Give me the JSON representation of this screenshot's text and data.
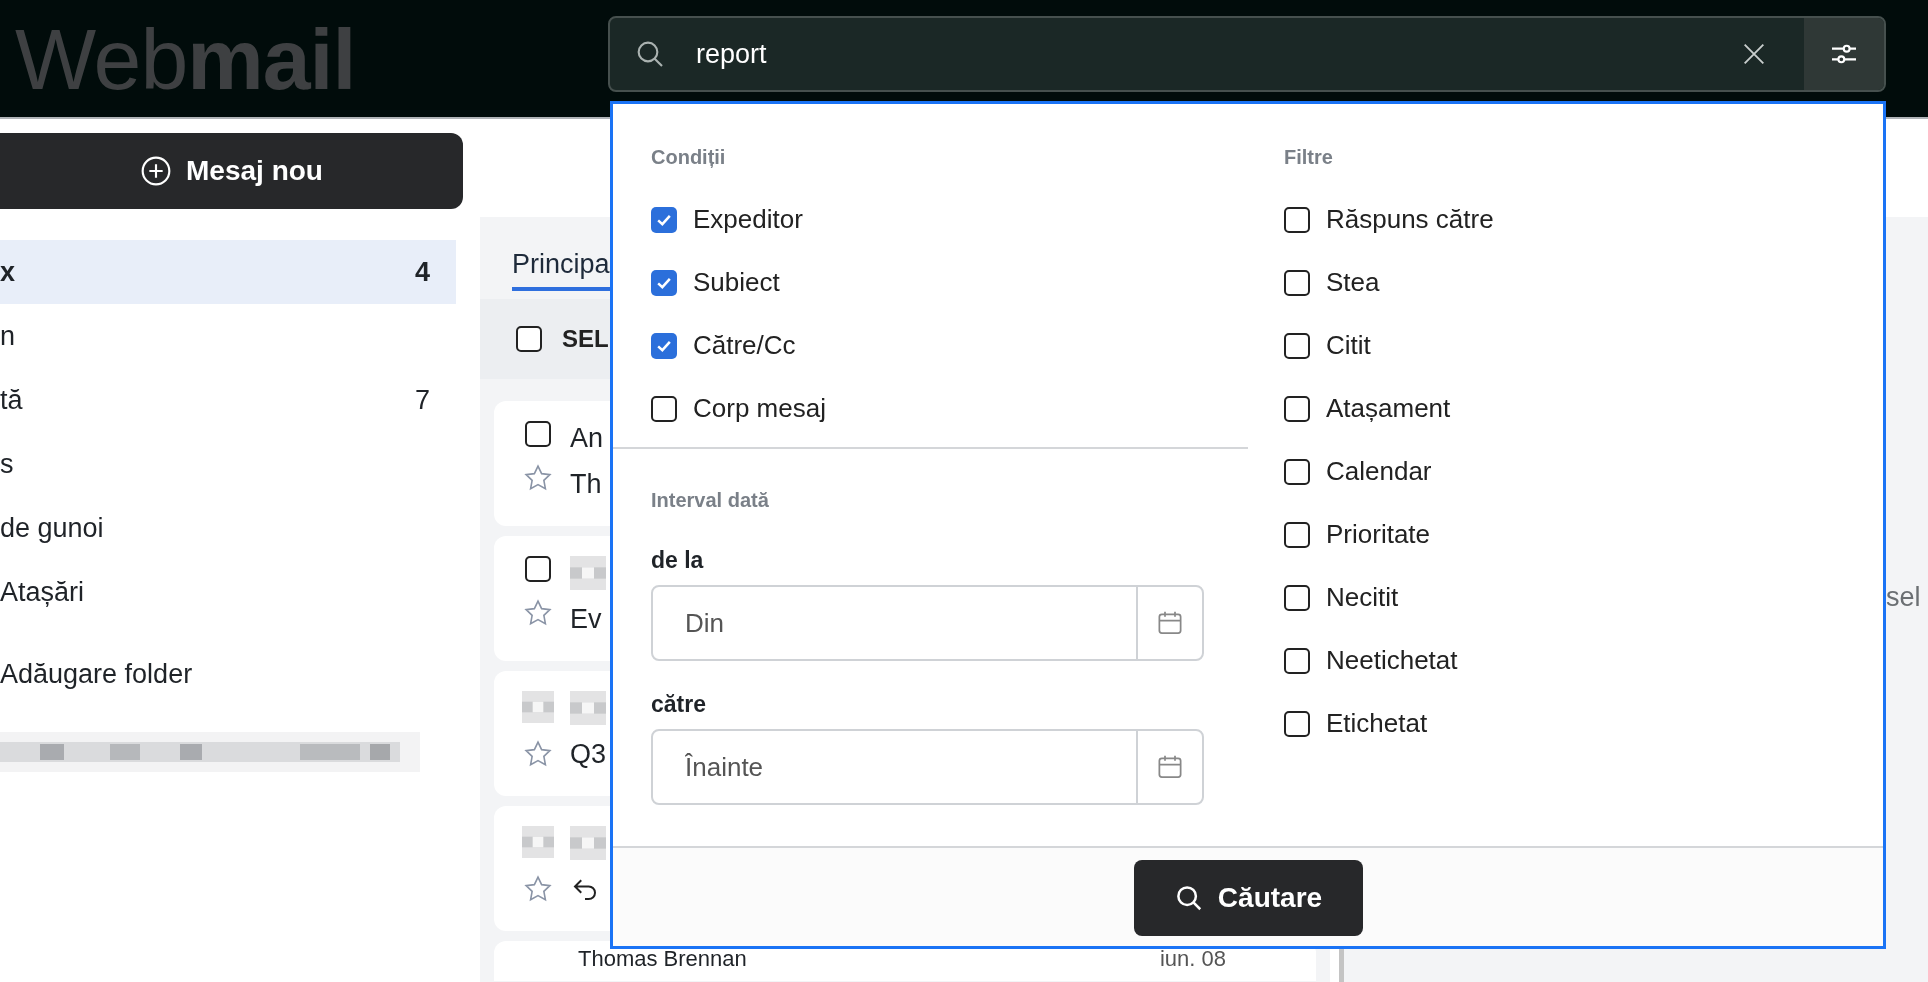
{
  "header": {
    "logo": "Web**mail**",
    "search": {
      "value": "report"
    }
  },
  "sidebar": {
    "compose": "Mesaj nou",
    "folders": [
      {
        "label": "x",
        "count": "4",
        "selected": true
      },
      {
        "label": "n",
        "selected": false
      },
      {
        "label": "tă",
        "count": "7",
        "selected": false
      },
      {
        "label": "s",
        "selected": false
      },
      {
        "label": "de gunoi",
        "selected": false
      },
      {
        "label": "Atașări",
        "selected": false
      }
    ],
    "add_folder": "Adăugare folder"
  },
  "mail_list": {
    "tabs": [
      {
        "label": "Principa",
        "selected": true
      }
    ],
    "select_all": {
      "label": "SEL",
      "checked": false
    },
    "messages": [
      {
        "kind": "checkbox",
        "checked": false,
        "starred": false,
        "sender": "An",
        "subject": "Th"
      },
      {
        "kind": "checkbox",
        "checked": false,
        "starred": false,
        "subject": "Ev"
      },
      {
        "kind": "avatar",
        "starred": false,
        "subject": "Q3"
      },
      {
        "kind": "avatar",
        "starred": false,
        "replied": true
      }
    ],
    "last_message": {
      "sender": "Thomas Brennan",
      "date": "iun. 08"
    }
  },
  "reading_pane": {
    "text": "sel"
  },
  "search_panel": {
    "conditions": {
      "title": "Condiții",
      "options": [
        {
          "label": "Expeditor",
          "checked": true
        },
        {
          "label": "Subiect",
          "checked": true
        },
        {
          "label": "Către/Cc",
          "checked": true
        },
        {
          "label": "Corp mesaj",
          "checked": false
        }
      ]
    },
    "date_range": {
      "title": "Interval dată",
      "from": {
        "label": "de la",
        "placeholder": "Din"
      },
      "to": {
        "label": "către",
        "placeholder": "Înainte"
      }
    },
    "filters": {
      "title": "Filtre",
      "options": [
        {
          "label": "Răspuns către",
          "checked": false
        },
        {
          "label": "Stea",
          "checked": false
        },
        {
          "label": "Citit",
          "checked": false
        },
        {
          "label": "Atașament",
          "checked": false
        },
        {
          "label": "Calendar",
          "checked": false
        },
        {
          "label": "Prioritate",
          "checked": false
        },
        {
          "label": "Necitit",
          "checked": false
        },
        {
          "label": "Neetichetat",
          "checked": false
        },
        {
          "label": "Etichetat",
          "checked": false
        }
      ]
    },
    "submit": "Căutare"
  }
}
